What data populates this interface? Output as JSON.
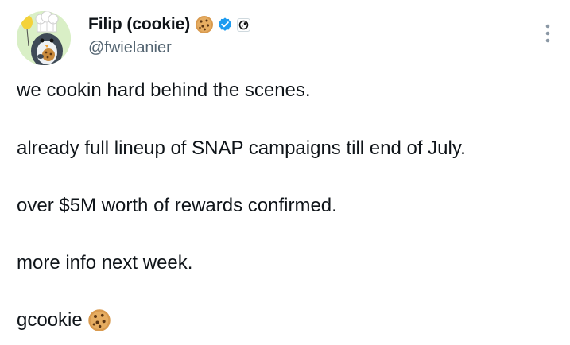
{
  "author": {
    "display_name": "Filip (cookie)",
    "handle": "@fwielanier",
    "name_emoji": "cookie-emoji",
    "verified": true,
    "affiliate_badge": "cookie-logo-badge",
    "avatar": "penguin-chef-avatar"
  },
  "more_menu": {
    "icon": "more-vertical-icon"
  },
  "tweet": {
    "lines": [
      "we cookin hard behind the scenes.",
      "already full lineup of SNAP campaigns till end of July.",
      "over $5M worth of rewards confirmed.",
      "more info next week.",
      "gcookie"
    ],
    "trailing_emoji": "cookie-emoji"
  },
  "colors": {
    "text": "#0f1419",
    "secondary": "#536471",
    "verified_blue": "#1d9bf0",
    "background": "#ffffff"
  }
}
